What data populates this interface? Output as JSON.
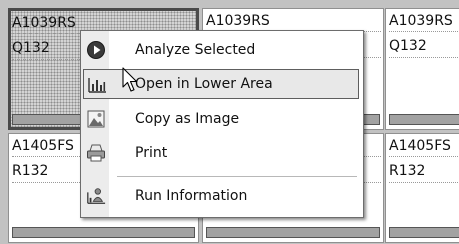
{
  "grid": {
    "row1": [
      {
        "line1": "A1039RS",
        "line2": "Q132",
        "selected": true
      },
      {
        "line1": "A1039RS",
        "line2": "",
        "selected": false
      },
      {
        "line1": "A1039RS",
        "line2": "Q132",
        "selected": false
      }
    ],
    "row2": [
      {
        "line1": "A1405FS",
        "line2": "R132",
        "selected": false
      },
      {
        "line1": "",
        "line2": "",
        "selected": false
      },
      {
        "line1": "A1405FS",
        "line2": "R132",
        "selected": false
      }
    ]
  },
  "context_menu": {
    "items": [
      {
        "label": "Analyze Selected",
        "icon": "play-circle-icon"
      },
      {
        "label": "Open in Lower Area",
        "icon": "bar-chart-icon",
        "highlighted": true
      },
      {
        "label": "Copy as Image",
        "icon": "image-icon"
      },
      {
        "label": "Print",
        "icon": "printer-icon"
      },
      {
        "label": "Run Information",
        "icon": "run-info-icon"
      }
    ]
  }
}
